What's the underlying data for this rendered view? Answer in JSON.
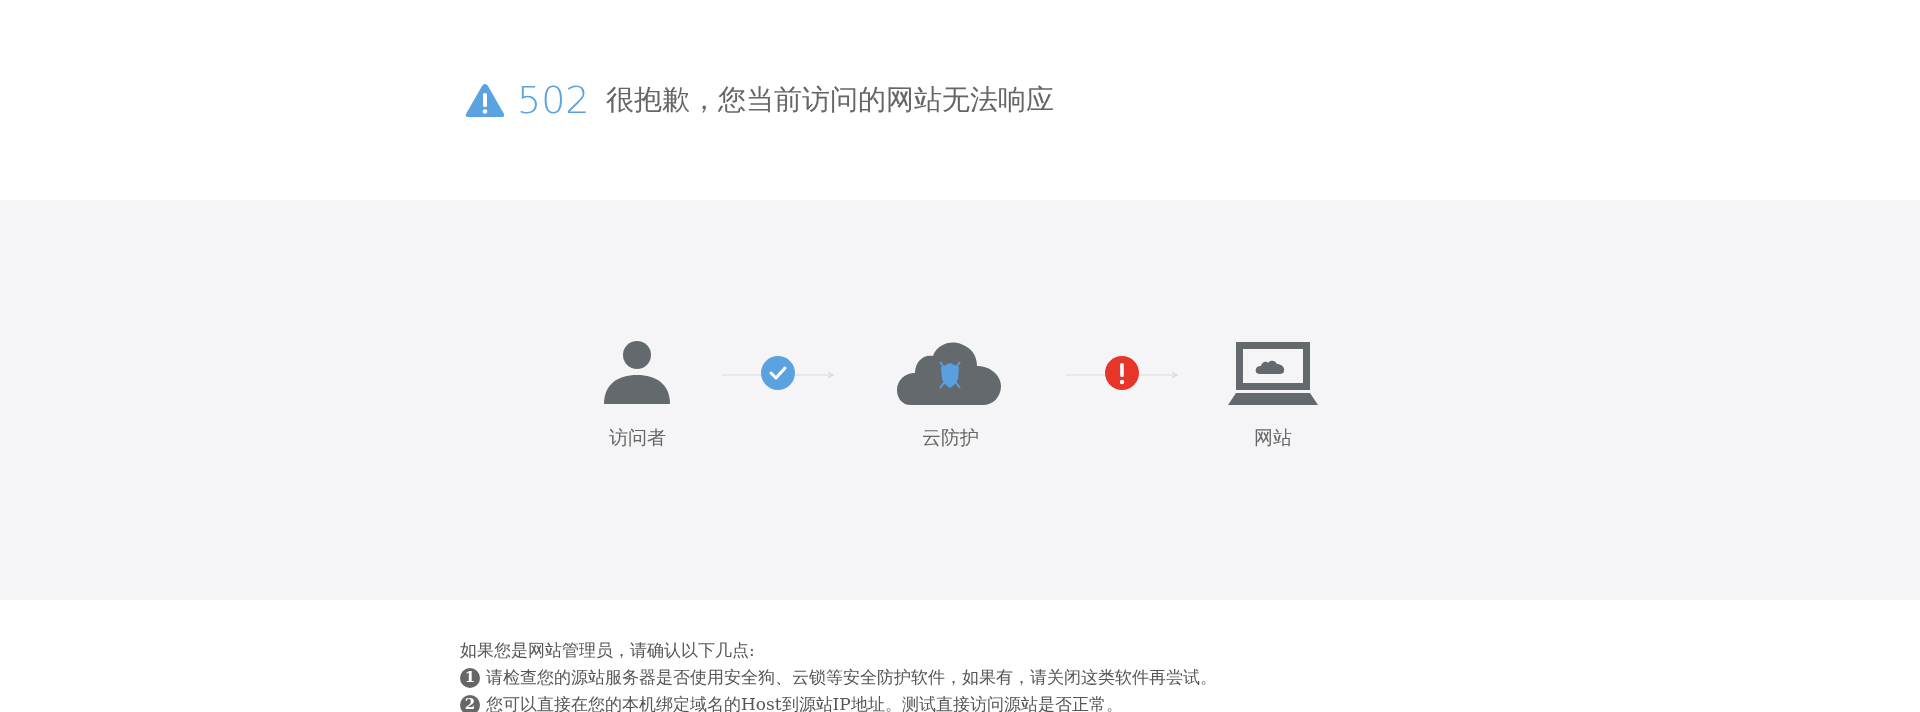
{
  "header": {
    "code": "502",
    "message": "很抱歉，您当前访问的网站无法响应"
  },
  "diagram": {
    "nodes": [
      {
        "kind": "visitor",
        "label": "访问者"
      },
      {
        "kind": "cloud",
        "label": "云防护"
      },
      {
        "kind": "website",
        "label": "网站"
      }
    ],
    "links": [
      {
        "kind": "ok"
      },
      {
        "kind": "error"
      }
    ]
  },
  "help": {
    "intro": "如果您是网站管理员，请确认以下几点:",
    "steps": [
      {
        "number": "1",
        "text": "请检查您的源站服务器是否使用安全狗、云锁等安全防护软件，如果有，请关闭这类软件再尝试。"
      },
      {
        "number": "2",
        "text": "您可以直接在您的本机绑定域名的Host到源站IP地址。测试直接访问源站是否正常。"
      }
    ]
  }
}
